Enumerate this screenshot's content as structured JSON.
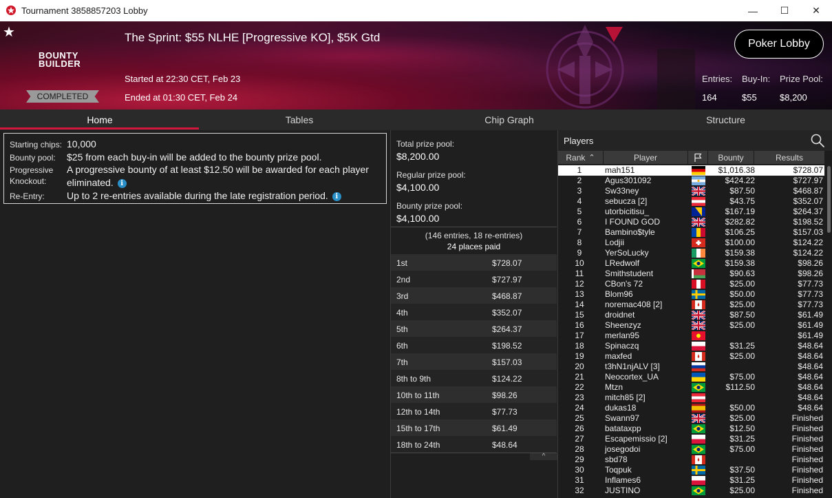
{
  "window": {
    "title": "Tournament 3858857203 Lobby",
    "minimize": "—",
    "maximize": "☐",
    "close": "✕"
  },
  "banner": {
    "star": "★",
    "logo_line1": "BOUNTY",
    "logo_line2": "BUILDER",
    "status": "COMPLETED",
    "title": "The Sprint: $55 NLHE [Progressive KO], $5K Gtd",
    "started": "Started at 22:30 CET, Feb 23",
    "ended": "Ended at 01:30 CET, Feb 24",
    "poker_lobby": "Poker Lobby",
    "entries_label": "Entries:",
    "entries_value": "164",
    "buyin_label": "Buy-In:",
    "buyin_value": "$55",
    "prizepool_label": "Prize Pool:",
    "prizepool_value": "$8,200"
  },
  "tabs": [
    "Home",
    "Tables",
    "Chip Graph",
    "Structure"
  ],
  "home": {
    "starting_chips_label": "Starting chips:",
    "starting_chips_value": "10,000",
    "bounty_pool_label": "Bounty pool:",
    "bounty_pool_value": "$25 from each buy-in will be added to the bounty prize pool.",
    "pko_label_1": "Progressive",
    "pko_label_2": "Knockout:",
    "pko_value_1": "A progressive bounty of at least $12.50 will be awarded for each player",
    "pko_value_2": "eliminated.",
    "reentry_label": "Re-Entry:",
    "reentry_value": "Up to 2 re-entries available during the late registration period.",
    "info_glyph": "i"
  },
  "prizes": {
    "total_label": "Total prize pool:",
    "total_value": "$8,200.00",
    "regular_label": "Regular prize pool:",
    "regular_value": "$4,100.00",
    "bounty_label": "Bounty prize pool:",
    "bounty_value": "$4,100.00",
    "entries_note": "(146 entries, 18 re-entries)",
    "places_paid": "24 places paid",
    "payouts": [
      {
        "pos": "1st",
        "amt": "$728.07"
      },
      {
        "pos": "2nd",
        "amt": "$727.97"
      },
      {
        "pos": "3rd",
        "amt": "$468.87"
      },
      {
        "pos": "4th",
        "amt": "$352.07"
      },
      {
        "pos": "5th",
        "amt": "$264.37"
      },
      {
        "pos": "6th",
        "amt": "$198.52"
      },
      {
        "pos": "7th",
        "amt": "$157.03"
      },
      {
        "pos": "8th to 9th",
        "amt": "$124.22"
      },
      {
        "pos": "10th to 11th",
        "amt": "$98.26"
      },
      {
        "pos": "12th to 14th",
        "amt": "$77.73"
      },
      {
        "pos": "15th to 17th",
        "amt": "$61.49"
      },
      {
        "pos": "18th to 24th",
        "amt": "$48.64"
      }
    ],
    "collapse_glyph": "^"
  },
  "players": {
    "title": "Players",
    "columns": {
      "rank": "Rank",
      "player": "Player",
      "bounty": "Bounty",
      "results": "Results"
    },
    "rows": [
      {
        "rank": "1",
        "name": "mah151",
        "flag": "de",
        "bounty": "$1,016.38",
        "result": "$728.07"
      },
      {
        "rank": "2",
        "name": "Agus301092",
        "flag": "ar",
        "bounty": "$424.22",
        "result": "$727.97"
      },
      {
        "rank": "3",
        "name": "Sw33ney",
        "flag": "gb",
        "bounty": "$87.50",
        "result": "$468.87"
      },
      {
        "rank": "4",
        "name": "sebucza [2]",
        "flag": "at",
        "bounty": "$43.75",
        "result": "$352.07"
      },
      {
        "rank": "5",
        "name": "utorbicitisu_",
        "flag": "ba",
        "bounty": "$167.19",
        "result": "$264.37"
      },
      {
        "rank": "6",
        "name": "I FOUND GOD",
        "flag": "gb",
        "bounty": "$282.82",
        "result": "$198.52"
      },
      {
        "rank": "7",
        "name": "Bambino$tyle",
        "flag": "md",
        "bounty": "$106.25",
        "result": "$157.03"
      },
      {
        "rank": "8",
        "name": "Lodjii",
        "flag": "ch",
        "bounty": "$100.00",
        "result": "$124.22"
      },
      {
        "rank": "9",
        "name": "YerSoLucky",
        "flag": "ie",
        "bounty": "$159.38",
        "result": "$124.22"
      },
      {
        "rank": "10",
        "name": "LRedwolf",
        "flag": "br",
        "bounty": "$159.38",
        "result": "$98.26"
      },
      {
        "rank": "11",
        "name": "Smithstudent",
        "flag": "by",
        "bounty": "$90.63",
        "result": "$98.26"
      },
      {
        "rank": "12",
        "name": "CBon's 72",
        "flag": "pe",
        "bounty": "$25.00",
        "result": "$77.73"
      },
      {
        "rank": "13",
        "name": "Blom96",
        "flag": "se",
        "bounty": "$50.00",
        "result": "$77.73"
      },
      {
        "rank": "14",
        "name": "noremac408 [2]",
        "flag": "ca",
        "bounty": "$25.00",
        "result": "$77.73"
      },
      {
        "rank": "15",
        "name": "droidnet",
        "flag": "gb",
        "bounty": "$87.50",
        "result": "$61.49"
      },
      {
        "rank": "16",
        "name": "Sheenzyz",
        "flag": "gb",
        "bounty": "$25.00",
        "result": "$61.49"
      },
      {
        "rank": "17",
        "name": "merlan95",
        "flag": "kg",
        "bounty": "",
        "result": "$61.49"
      },
      {
        "rank": "18",
        "name": "Spinaczq",
        "flag": "pl",
        "bounty": "$31.25",
        "result": "$48.64"
      },
      {
        "rank": "19",
        "name": "maxfed",
        "flag": "ca",
        "bounty": "$25.00",
        "result": "$48.64"
      },
      {
        "rank": "20",
        "name": "t3hN1njALV [3]",
        "flag": "ru",
        "bounty": "",
        "result": "$48.64"
      },
      {
        "rank": "21",
        "name": "Neocortex_UA",
        "flag": "ua",
        "bounty": "$75.00",
        "result": "$48.64"
      },
      {
        "rank": "22",
        "name": "Mtzn",
        "flag": "br",
        "bounty": "$112.50",
        "result": "$48.64"
      },
      {
        "rank": "23",
        "name": "mitch85 [2]",
        "flag": "at",
        "bounty": "",
        "result": "$48.64"
      },
      {
        "rank": "24",
        "name": "dukas18",
        "flag": "es",
        "bounty": "$50.00",
        "result": "$48.64"
      },
      {
        "rank": "25",
        "name": "Swann97",
        "flag": "gb",
        "bounty": "$25.00",
        "result": "Finished"
      },
      {
        "rank": "26",
        "name": "batataxpp",
        "flag": "br",
        "bounty": "$12.50",
        "result": "Finished"
      },
      {
        "rank": "27",
        "name": "Escapemissio [2]",
        "flag": "pl",
        "bounty": "$31.25",
        "result": "Finished"
      },
      {
        "rank": "28",
        "name": "josegodoi",
        "flag": "br",
        "bounty": "$75.00",
        "result": "Finished"
      },
      {
        "rank": "29",
        "name": "sbd78",
        "flag": "ca",
        "bounty": "",
        "result": "Finished"
      },
      {
        "rank": "30",
        "name": "Toqpuk",
        "flag": "se",
        "bounty": "$37.50",
        "result": "Finished"
      },
      {
        "rank": "31",
        "name": "Inflames6",
        "flag": "pl",
        "bounty": "$31.25",
        "result": "Finished"
      },
      {
        "rank": "32",
        "name": "JUSTINO",
        "flag": "br",
        "bounty": "$25.00",
        "result": "Finished"
      }
    ]
  }
}
